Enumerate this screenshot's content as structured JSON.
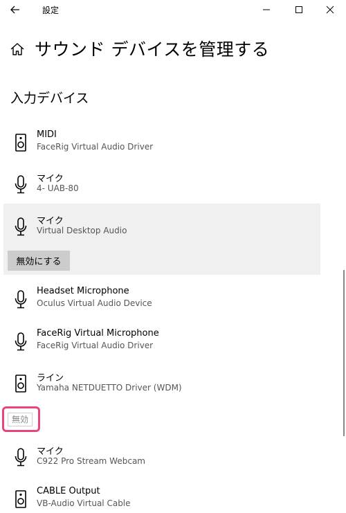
{
  "window": {
    "title": "設定"
  },
  "header": {
    "title": "サウンド デバイスを管理する"
  },
  "section": {
    "title": "入力デバイス"
  },
  "devices": [
    {
      "name": "MIDI",
      "subtitle": "FaceRig Virtual Audio Driver",
      "icon": "speaker-icon"
    },
    {
      "name": "マイク",
      "subtitle": "4- UAB-80",
      "icon": "microphone-icon"
    },
    {
      "name": "マイク",
      "subtitle": "Virtual Desktop Audio",
      "icon": "microphone-icon"
    },
    {
      "name": "Headset Microphone",
      "subtitle": "Oculus Virtual Audio Device",
      "icon": "microphone-icon"
    },
    {
      "name": "FaceRig Virtual Microphone",
      "subtitle": "FaceRig Virtual Audio Driver",
      "icon": "microphone-icon"
    },
    {
      "name": "ライン",
      "subtitle": "Yamaha NETDUETTO Driver (WDM)",
      "icon": "speaker-icon"
    }
  ],
  "selected_action": {
    "label": "無効にする"
  },
  "disabled_group": {
    "label": "無効",
    "highlight_color": "#e6467a",
    "devices": [
      {
        "name": "マイク",
        "subtitle": "C922 Pro Stream Webcam",
        "icon": "microphone-icon"
      },
      {
        "name": "CABLE Output",
        "subtitle": "VB-Audio Virtual Cable",
        "icon": "speaker-icon"
      }
    ]
  },
  "colors": {
    "selected_bg": "#f0f0f0",
    "button_bg": "#cccccc",
    "highlight": "#e6467a"
  }
}
